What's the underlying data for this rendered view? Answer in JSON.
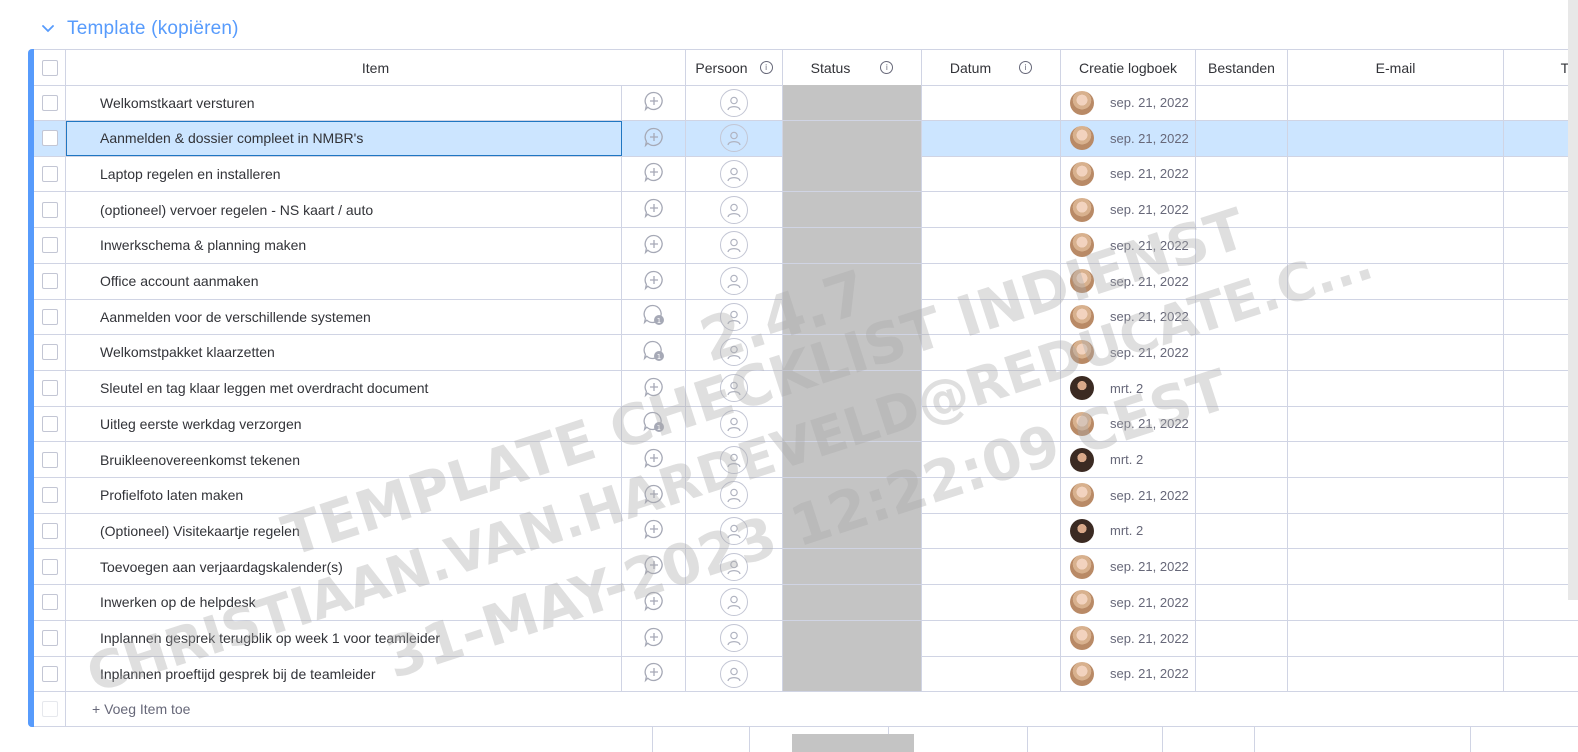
{
  "group": {
    "title": "Template (kopiëren)",
    "color": "#579bfc"
  },
  "columns": {
    "item": "Item",
    "persoon": "Persoon",
    "status": "Status",
    "datum": "Datum",
    "creatie": "Creatie logboek",
    "bestanden": "Bestanden",
    "email": "E-mail",
    "tel": "Tele"
  },
  "rows": [
    {
      "item": "Welkomstkaart versturen",
      "date": "sep. 21, 2022",
      "avatar": "light",
      "updates": 0
    },
    {
      "item": "Aanmelden & dossier compleet in NMBR's",
      "date": "sep. 21, 2022",
      "avatar": "light",
      "updates": 0
    },
    {
      "item": "Laptop regelen en installeren",
      "date": "sep. 21, 2022",
      "avatar": "light",
      "updates": 0
    },
    {
      "item": "(optioneel) vervoer regelen - NS kaart / auto",
      "date": "sep. 21, 2022",
      "avatar": "light",
      "updates": 0
    },
    {
      "item": "Inwerkschema & planning maken",
      "date": "sep. 21, 2022",
      "avatar": "light",
      "updates": 0
    },
    {
      "item": "Office account aanmaken",
      "date": "sep. 21, 2022",
      "avatar": "light",
      "updates": 0
    },
    {
      "item": "Aanmelden voor de verschillende systemen",
      "date": "sep. 21, 2022",
      "avatar": "light",
      "updates": 1
    },
    {
      "item": "Welkomstpakket klaarzetten",
      "date": "sep. 21, 2022",
      "avatar": "light",
      "updates": 1
    },
    {
      "item": "Sleutel en tag klaar leggen met overdracht document",
      "date": "mrt. 2",
      "avatar": "dark",
      "updates": 0
    },
    {
      "item": "Uitleg eerste werkdag verzorgen",
      "date": "sep. 21, 2022",
      "avatar": "light",
      "updates": 1
    },
    {
      "item": "Bruikleenovereenkomst tekenen",
      "date": "mrt. 2",
      "avatar": "dark",
      "updates": 0
    },
    {
      "item": "Profielfoto laten maken",
      "date": "sep. 21, 2022",
      "avatar": "light",
      "updates": 0
    },
    {
      "item": "(Optioneel) Visitekaartje regelen",
      "date": "mrt. 2",
      "avatar": "dark",
      "updates": 0
    },
    {
      "item": "Toevoegen aan verjaardagskalender(s)",
      "date": "sep. 21, 2022",
      "avatar": "light",
      "updates": 0
    },
    {
      "item": "Inwerken op de helpdesk",
      "date": "sep. 21, 2022",
      "avatar": "light",
      "updates": 0
    },
    {
      "item": "Inplannen gesprek terugblik op week 1 voor teamleider",
      "date": "sep. 21, 2022",
      "avatar": "light",
      "updates": 0
    },
    {
      "item": "Inplannen proeftijd gesprek bij de teamleider",
      "date": "sep. 21, 2022",
      "avatar": "light",
      "updates": 0
    }
  ],
  "selected_row": 1,
  "add_item_label": "+ Voeg Item toe",
  "watermark": [
    "2.4.7",
    "TEMPLATE CHECKLIST INDIENST",
    "CHRISTIAAN.VAN.HARDEVELD@REDUCATE.C...",
    "31-MAY-2023 12:22:09 CEST"
  ],
  "colors": {
    "status_empty": "#c4c4c4",
    "selected_row": "#cce5ff",
    "border": "#d0d4e4"
  }
}
